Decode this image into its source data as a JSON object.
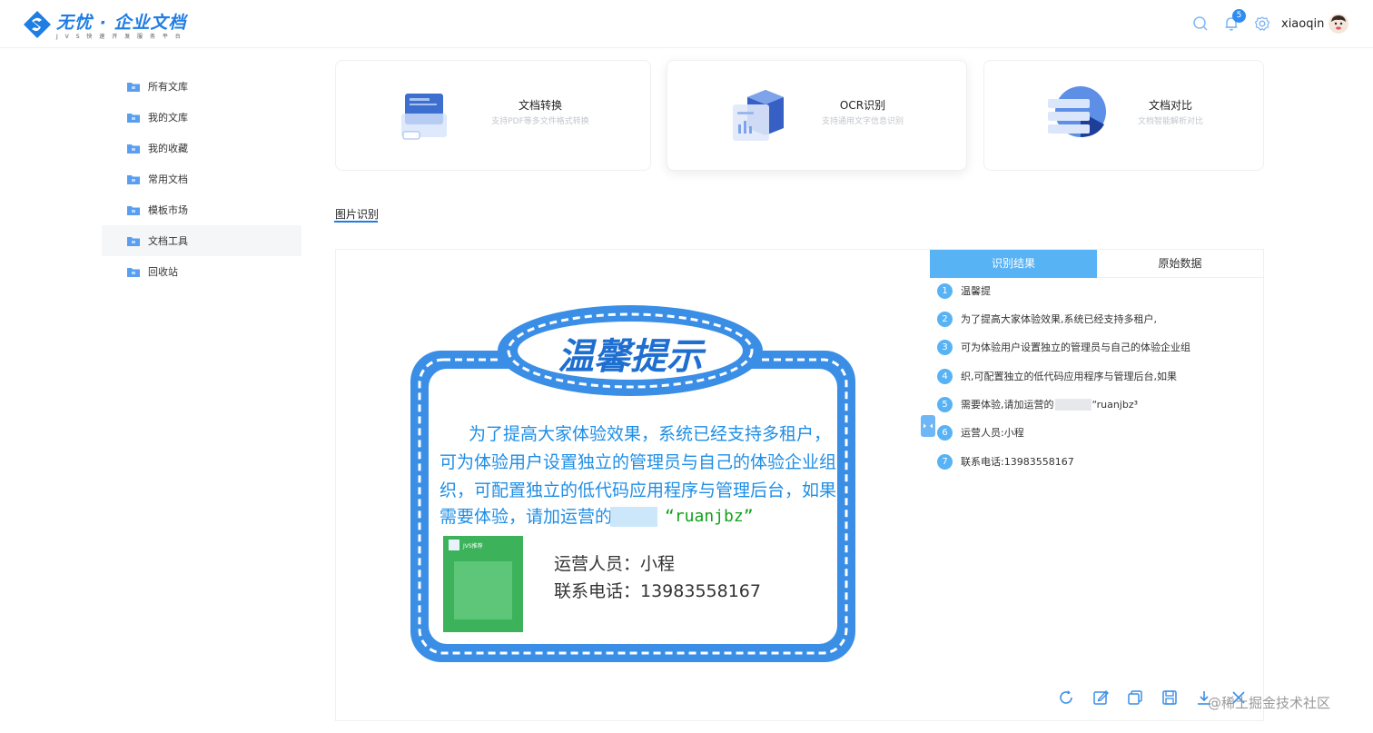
{
  "brand": {
    "name": "无忧 · 企业文档",
    "subtitle": "J V S 快 速 开 发 服 务 平 台"
  },
  "header": {
    "notification_count": "5",
    "username": "xiaoqin"
  },
  "sidebar": {
    "items": [
      {
        "label": "所有文库",
        "icon": "folder-icon"
      },
      {
        "label": "我的文库",
        "icon": "folder-icon"
      },
      {
        "label": "我的收藏",
        "icon": "folder-icon"
      },
      {
        "label": "常用文档",
        "icon": "folder-icon"
      },
      {
        "label": "模板市场",
        "icon": "folder-icon"
      },
      {
        "label": "文档工具",
        "icon": "folder-icon",
        "active": true
      },
      {
        "label": "回收站",
        "icon": "folder-icon"
      }
    ]
  },
  "tools": [
    {
      "title": "文档转换",
      "subtitle": "支持PDF等多文件格式转换"
    },
    {
      "title": "OCR识别",
      "subtitle": "支持通用文字信息识别"
    },
    {
      "title": "文档对比",
      "subtitle": "文档智能解析对比"
    }
  ],
  "section_tab": "图片识别",
  "poster": {
    "heading": "温馨提示",
    "lines": [
      "为了提高大家体验效果，系统已经支持多租户，",
      "可为体验用户设置独立的管理员与自己的体验企业组",
      "织，可配置独立的低代码应用程序与管理后台，如果",
      "需要体验，请加运营的"
    ],
    "wechat": "“ruanjbz”",
    "staff": "运营人员：小程",
    "phone": "联系电话：13983558167",
    "qr_label": "JVS推荐"
  },
  "result_tabs": {
    "active": "识别结果",
    "inactive": "原始数据"
  },
  "results": [
    {
      "n": "1",
      "text": "温馨提"
    },
    {
      "n": "2",
      "text": "为了提高大家体验效果,系统已经支持多租户,"
    },
    {
      "n": "3",
      "text": "可为体验用户设置独立的管理员与自己的体验企业组"
    },
    {
      "n": "4",
      "text": "织,可配置独立的低代码应用程序与管理后台,如果"
    },
    {
      "n": "5",
      "text": "需要体验,请加运营的",
      "suffix": "“ruanjbz³"
    },
    {
      "n": "6",
      "text": "运营人员:小程"
    },
    {
      "n": "7",
      "text": "联系电话:13983558167"
    }
  ],
  "actions": [
    "refresh-icon",
    "edit-icon",
    "copy-icon",
    "save-icon",
    "download-icon",
    "close-icon"
  ],
  "watermark": "@稀土掘金技术社区",
  "colors": {
    "primary": "#1f7de4",
    "accent": "#58b3f5",
    "highlight_red": "#ef4040",
    "wechat_green": "#12a21a"
  }
}
